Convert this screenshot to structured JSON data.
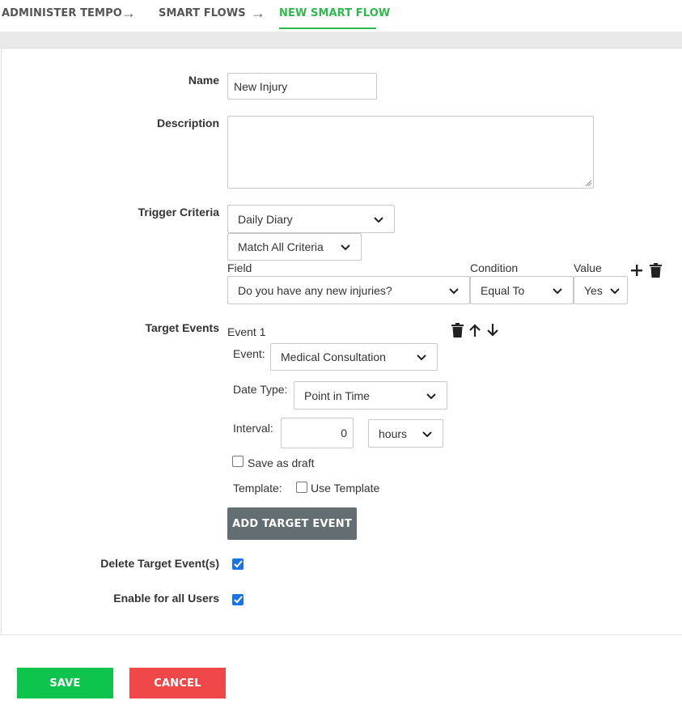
{
  "breadcrumb": {
    "items": [
      "ADMINISTER TEMPO",
      "SMART FLOWS",
      "NEW SMART FLOW"
    ],
    "arrow": "→",
    "active_color": "#2fb84d"
  },
  "form": {
    "name_label": "Name",
    "name_value": "New Injury",
    "description_label": "Description",
    "description_value": "",
    "trigger_label": "Trigger Criteria",
    "trigger_source": "Daily Diary",
    "match_mode": "Match All Criteria",
    "criteria_headers": {
      "field": "Field",
      "condition": "Condition",
      "value": "Value"
    },
    "criteria_row": {
      "field": "Do you have any new injuries?",
      "condition": "Equal To",
      "value": "Yes"
    },
    "target_label": "Target Events",
    "event": {
      "title": "Event 1",
      "event_label": "Event:",
      "event_value": "Medical Consultation",
      "date_type_label": "Date Type:",
      "date_type_value": "Point in Time",
      "interval_label": "Interval:",
      "interval_value": "0",
      "interval_unit": "hours",
      "save_draft_label": "Save as draft",
      "save_draft_checked": false,
      "template_label": "Template:",
      "use_template_label": "Use Template",
      "use_template_checked": false
    },
    "add_target_label": "ADD TARGET EVENT",
    "delete_target_label": "Delete Target Event(s)",
    "delete_target_checked": true,
    "enable_all_label": "Enable for all Users",
    "enable_all_checked": true
  },
  "footer": {
    "save_label": "SAVE",
    "cancel_label": "CANCEL",
    "save_color": "#0dc44c",
    "cancel_color": "#f04848"
  },
  "icons": [
    "plus-icon",
    "trash-icon",
    "arrow-up-icon",
    "arrow-down-icon",
    "chevron-down-icon",
    "checkmark-icon"
  ]
}
